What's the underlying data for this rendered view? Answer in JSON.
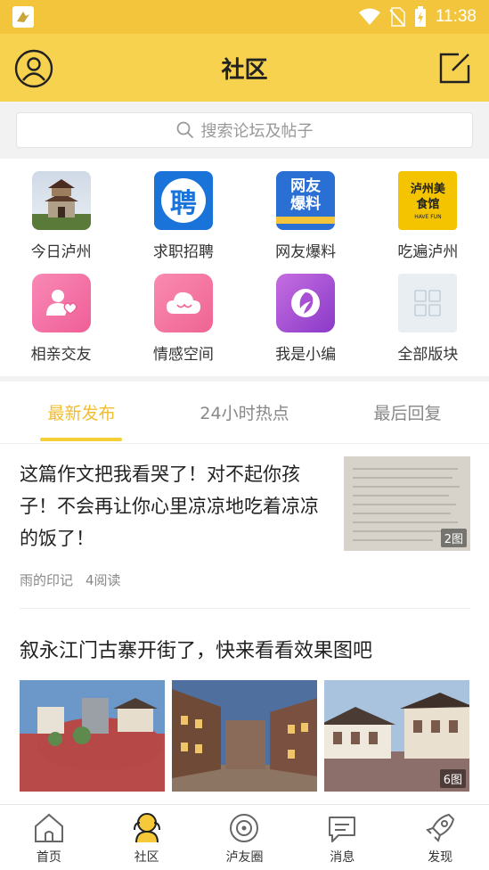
{
  "status_bar": {
    "time": "11:38",
    "app_notification_icon": "bird-app-icon",
    "wifi_icon": "wifi-icon",
    "signal_icon": "no-sim-icon",
    "battery_icon": "battery-charging-icon"
  },
  "header": {
    "title": "社区",
    "left_icon": "user-profile-icon",
    "right_icon": "edit-icon"
  },
  "search": {
    "placeholder": "搜索论坛及帖子",
    "icon": "search-icon"
  },
  "grid": [
    {
      "label": "今日泸州",
      "icon": "city-tower-icon"
    },
    {
      "label": "求职招聘",
      "icon": "recruit-icon",
      "glyph": "聘"
    },
    {
      "label": "网友爆料",
      "icon": "netizen-report-icon",
      "glyph": "网友爆料"
    },
    {
      "label": "吃遍泸州",
      "icon": "food-icon",
      "glyph": "泸州美食馆",
      "sub_glyph": "HAVE FUN"
    },
    {
      "label": "相亲交友",
      "icon": "dating-icon"
    },
    {
      "label": "情感空间",
      "icon": "emotion-cloud-icon"
    },
    {
      "label": "我是小编",
      "icon": "editor-icon"
    },
    {
      "label": "全部版块",
      "icon": "all-sections-icon"
    }
  ],
  "tabs": [
    {
      "label": "最新发布",
      "active": true
    },
    {
      "label": "24小时热点",
      "active": false
    },
    {
      "label": "最后回复",
      "active": false
    }
  ],
  "posts": [
    {
      "title": "这篇作文把我看哭了！对不起你孩子！不会再让你心里凉凉地吃着凉凉的饭了！",
      "author": "雨的印记",
      "reads": "4阅读",
      "image_count": "2图"
    },
    {
      "title": "叙永江门古寨开街了，快来看看效果图吧",
      "image_count": "6图"
    }
  ],
  "bottom_nav": [
    {
      "label": "首页",
      "icon": "home-icon"
    },
    {
      "label": "社区",
      "icon": "community-icon",
      "active": true
    },
    {
      "label": "泸友圈",
      "icon": "circle-icon"
    },
    {
      "label": "消息",
      "icon": "message-icon"
    },
    {
      "label": "发现",
      "icon": "discover-rocket-icon"
    }
  ],
  "colors": {
    "header_bg": "#f6d24e",
    "accent": "#f2bd2c",
    "recruit_blue": "#1a73d9"
  }
}
